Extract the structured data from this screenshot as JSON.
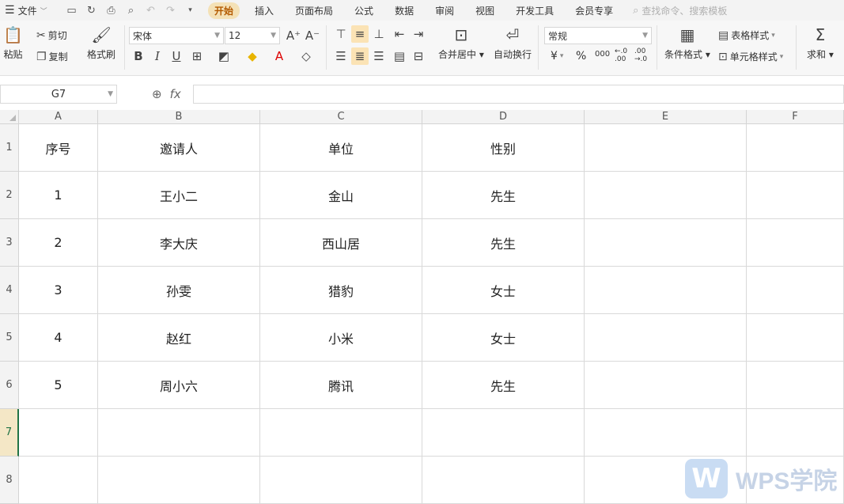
{
  "menubar": {
    "file_label": "文件",
    "tabs": [
      "开始",
      "插入",
      "页面布局",
      "公式",
      "数据",
      "审阅",
      "视图",
      "开发工具",
      "会员专享"
    ],
    "active_tab": "开始",
    "search_placeholder": "查找命令、搜索模板"
  },
  "ribbon": {
    "paste": "粘贴",
    "cut": "剪切",
    "copy": "复制",
    "format_painter": "格式刷",
    "font_name": "宋体",
    "font_size": "12",
    "bold": "B",
    "italic": "I",
    "underline": "U",
    "merge_center": "合并居中",
    "wrap_text": "自动换行",
    "number_format": "常规",
    "currency": "¥",
    "percent": "%",
    "thousands": "000",
    "dec_increase": "←.0 .00",
    "dec_decrease": ".00 →.0",
    "conditional_format": "条件格式",
    "table_style": "表格样式",
    "cell_style": "单元格样式",
    "sum": "求和"
  },
  "formula_bar": {
    "name_box": "G7",
    "fx": "fx",
    "formula": ""
  },
  "sheet": {
    "columns": [
      "A",
      "B",
      "C",
      "D",
      "E",
      "F"
    ],
    "rows": [
      "1",
      "2",
      "3",
      "4",
      "5",
      "6",
      "7",
      "8"
    ],
    "active_row": "7",
    "data": [
      [
        "序号",
        "邀请人",
        "单位",
        "性别",
        "",
        ""
      ],
      [
        "1",
        "王小二",
        "金山",
        "先生",
        "",
        ""
      ],
      [
        "2",
        "李大庆",
        "西山居",
        "先生",
        "",
        ""
      ],
      [
        "3",
        "孙雯",
        "猎豹",
        "女士",
        "",
        ""
      ],
      [
        "4",
        "赵红",
        "小米",
        "女士",
        "",
        ""
      ],
      [
        "5",
        "周小六",
        "腾讯",
        "先生",
        "",
        ""
      ],
      [
        "",
        "",
        "",
        "",
        "",
        ""
      ],
      [
        "",
        "",
        "",
        "",
        "",
        ""
      ]
    ]
  },
  "watermark": {
    "logo": "W",
    "text": "WPS学院"
  },
  "colors": {
    "active_tab_bg": "#f4e1b6",
    "accent_green": "#217346"
  }
}
